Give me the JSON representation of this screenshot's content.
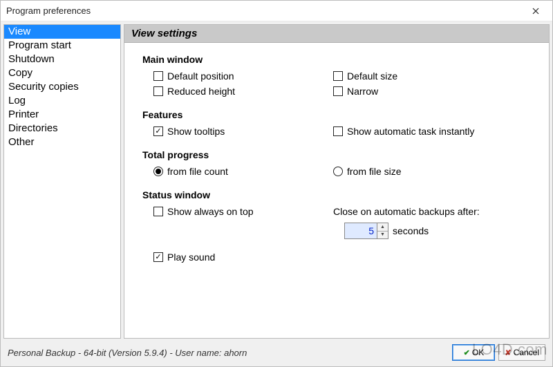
{
  "window": {
    "title": "Program preferences"
  },
  "sidebar": {
    "items": [
      {
        "label": "View",
        "selected": true
      },
      {
        "label": "Program start",
        "selected": false
      },
      {
        "label": "Shutdown",
        "selected": false
      },
      {
        "label": "Copy",
        "selected": false
      },
      {
        "label": "Security copies",
        "selected": false
      },
      {
        "label": "Log",
        "selected": false
      },
      {
        "label": "Printer",
        "selected": false
      },
      {
        "label": "Directories",
        "selected": false
      },
      {
        "label": "Other",
        "selected": false
      }
    ]
  },
  "main": {
    "header": "View settings",
    "sections": {
      "main_window": {
        "title": "Main window",
        "default_position": {
          "label": "Default position",
          "checked": false
        },
        "default_size": {
          "label": "Default size",
          "checked": false
        },
        "reduced_height": {
          "label": "Reduced height",
          "checked": false
        },
        "narrow": {
          "label": "Narrow",
          "checked": false
        }
      },
      "features": {
        "title": "Features",
        "show_tooltips": {
          "label": "Show tooltips",
          "checked": true
        },
        "show_auto_task": {
          "label": "Show automatic task instantly",
          "checked": false
        }
      },
      "total_progress": {
        "title": "Total progress",
        "from_file_count": {
          "label": "from file count",
          "checked": true
        },
        "from_file_size": {
          "label": "from file size",
          "checked": false
        }
      },
      "status_window": {
        "title": "Status window",
        "show_on_top": {
          "label": "Show always on top",
          "checked": false
        },
        "play_sound": {
          "label": "Play sound",
          "checked": true
        },
        "close_after_label": "Close on automatic backups after:",
        "close_after_value": "5",
        "close_after_unit": "seconds"
      }
    }
  },
  "footer": {
    "status": "Personal Backup - 64-bit (Version 5.9.4) - User name: ahorn",
    "ok": "OK",
    "cancel": "Cancel"
  },
  "watermark": "LO4D.com"
}
